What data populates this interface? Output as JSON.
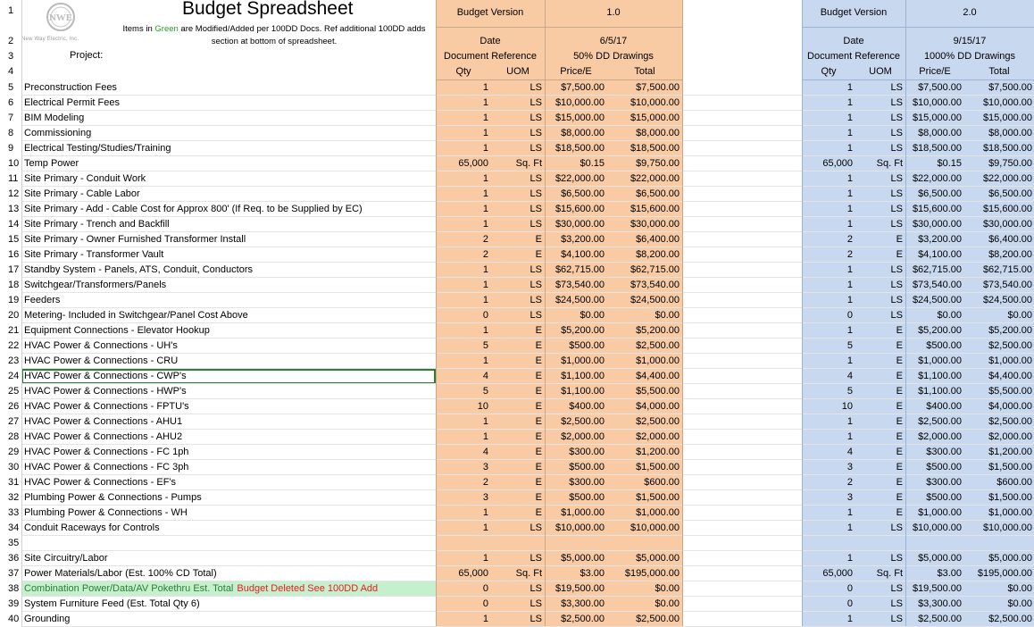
{
  "header": {
    "title": "Budget Spreadsheet",
    "logo_caption": "New Way Electric, Inc.",
    "note_prefix": "Items in ",
    "note_green": "Green",
    "note_suffix": " are Modified/Added per 100DD Docs. Ref additional 100DD adds section at bottom of spreadsheet.",
    "project_label": "Project:"
  },
  "version_a": {
    "version_label": "Budget Version",
    "version_value": "1.0",
    "date_label": "Date",
    "date_value": "6/5/17",
    "docref_label": "Document Reference",
    "docref_value": "50% DD Drawings",
    "col_qty": "Qty",
    "col_uom": "UOM",
    "col_price": "Price/E",
    "col_total": "Total"
  },
  "version_b": {
    "version_label": "Budget Version",
    "version_value": "2.0",
    "date_label": "Date",
    "date_value": "9/15/17",
    "docref_label": "Document Reference",
    "docref_value": "1000% DD Drawings",
    "col_qty": "Qty",
    "col_uom": "UOM",
    "col_price": "Price/E",
    "col_total": "Total"
  },
  "row_numbers": [
    "1",
    "2",
    "3",
    "4"
  ],
  "rows": [
    {
      "n": "5",
      "desc": "Preconstruction Fees",
      "a": [
        "1",
        "LS",
        "$7,500.00",
        "$7,500.00"
      ],
      "b": [
        "1",
        "LS",
        "$7,500.00",
        "$7,500.00"
      ]
    },
    {
      "n": "6",
      "desc": "Electrical Permit Fees",
      "a": [
        "1",
        "LS",
        "$10,000.00",
        "$10,000.00"
      ],
      "b": [
        "1",
        "LS",
        "$10,000.00",
        "$10,000.00"
      ]
    },
    {
      "n": "7",
      "desc": "BIM Modeling",
      "a": [
        "1",
        "LS",
        "$15,000.00",
        "$15,000.00"
      ],
      "b": [
        "1",
        "LS",
        "$15,000.00",
        "$15,000.00"
      ]
    },
    {
      "n": "8",
      "desc": "Commissioning",
      "a": [
        "1",
        "LS",
        "$8,000.00",
        "$8,000.00"
      ],
      "b": [
        "1",
        "LS",
        "$8,000.00",
        "$8,000.00"
      ]
    },
    {
      "n": "9",
      "desc": "Electrical Testing/Studies/Training",
      "a": [
        "1",
        "LS",
        "$18,500.00",
        "$18,500.00"
      ],
      "b": [
        "1",
        "LS",
        "$18,500.00",
        "$18,500.00"
      ]
    },
    {
      "n": "10",
      "desc": "Temp Power",
      "a": [
        "65,000",
        "Sq. Ft",
        "$0.15",
        "$9,750.00"
      ],
      "b": [
        "65,000",
        "Sq. Ft",
        "$0.15",
        "$9,750.00"
      ]
    },
    {
      "n": "11",
      "desc": "Site Primary - Conduit Work",
      "a": [
        "1",
        "LS",
        "$22,000.00",
        "$22,000.00"
      ],
      "b": [
        "1",
        "LS",
        "$22,000.00",
        "$22,000.00"
      ]
    },
    {
      "n": "12",
      "desc": "Site Primary - Cable Labor",
      "a": [
        "1",
        "LS",
        "$6,500.00",
        "$6,500.00"
      ],
      "b": [
        "1",
        "LS",
        "$6,500.00",
        "$6,500.00"
      ]
    },
    {
      "n": "13",
      "desc": "Site Primary - Add - Cable Cost for Approx 800' (If Req. to be Supplied by EC)",
      "a": [
        "1",
        "LS",
        "$15,600.00",
        "$15,600.00"
      ],
      "b": [
        "1",
        "LS",
        "$15,600.00",
        "$15,600.00"
      ]
    },
    {
      "n": "14",
      "desc": "Site Primary - Trench and Backfill",
      "a": [
        "1",
        "LS",
        "$30,000.00",
        "$30,000.00"
      ],
      "b": [
        "1",
        "LS",
        "$30,000.00",
        "$30,000.00"
      ]
    },
    {
      "n": "15",
      "desc": "Site Primary - Owner Furnished Transformer Install",
      "a": [
        "2",
        "E",
        "$3,200.00",
        "$6,400.00"
      ],
      "b": [
        "2",
        "E",
        "$3,200.00",
        "$6,400.00"
      ]
    },
    {
      "n": "16",
      "desc": "Site Primary - Transformer Vault",
      "a": [
        "2",
        "E",
        "$4,100.00",
        "$8,200.00"
      ],
      "b": [
        "2",
        "E",
        "$4,100.00",
        "$8,200.00"
      ]
    },
    {
      "n": "17",
      "desc": "Standby System - Panels, ATS, Conduit, Conductors",
      "a": [
        "1",
        "LS",
        "$62,715.00",
        "$62,715.00"
      ],
      "b": [
        "1",
        "LS",
        "$62,715.00",
        "$62,715.00"
      ]
    },
    {
      "n": "18",
      "desc": "Switchgear/Transformers/Panels",
      "a": [
        "1",
        "LS",
        "$73,540.00",
        "$73,540.00"
      ],
      "b": [
        "1",
        "LS",
        "$73,540.00",
        "$73,540.00"
      ]
    },
    {
      "n": "19",
      "desc": "Feeders",
      "a": [
        "1",
        "LS",
        "$24,500.00",
        "$24,500.00"
      ],
      "b": [
        "1",
        "LS",
        "$24,500.00",
        "$24,500.00"
      ]
    },
    {
      "n": "20",
      "desc": "Metering- Included in Switchgear/Panel Cost Above",
      "a": [
        "0",
        "LS",
        "$0.00",
        "$0.00"
      ],
      "b": [
        "0",
        "LS",
        "$0.00",
        "$0.00"
      ]
    },
    {
      "n": "21",
      "desc": "Equipment Connections - Elevator Hookup",
      "a": [
        "1",
        "E",
        "$5,200.00",
        "$5,200.00"
      ],
      "b": [
        "1",
        "E",
        "$5,200.00",
        "$5,200.00"
      ]
    },
    {
      "n": "22",
      "desc": "HVAC Power & Connections - UH's",
      "a": [
        "5",
        "E",
        "$500.00",
        "$2,500.00"
      ],
      "b": [
        "5",
        "E",
        "$500.00",
        "$2,500.00"
      ]
    },
    {
      "n": "23",
      "desc": "HVAC Power & Connections - CRU",
      "a": [
        "1",
        "E",
        "$1,000.00",
        "$1,000.00"
      ],
      "b": [
        "1",
        "E",
        "$1,000.00",
        "$1,000.00"
      ]
    },
    {
      "n": "24",
      "desc": "HVAC Power & Connections - CWP's",
      "a": [
        "4",
        "E",
        "$1,100.00",
        "$4,400.00"
      ],
      "b": [
        "4",
        "E",
        "$1,100.00",
        "$4,400.00"
      ],
      "selected": true
    },
    {
      "n": "25",
      "desc": "HVAC Power & Connections - HWP's",
      "a": [
        "5",
        "E",
        "$1,100.00",
        "$5,500.00"
      ],
      "b": [
        "5",
        "E",
        "$1,100.00",
        "$5,500.00"
      ]
    },
    {
      "n": "26",
      "desc": "HVAC Power & Connections - FPTU's",
      "a": [
        "10",
        "E",
        "$400.00",
        "$4,000.00"
      ],
      "b": [
        "10",
        "E",
        "$400.00",
        "$4,000.00"
      ]
    },
    {
      "n": "27",
      "desc": "HVAC Power & Connections - AHU1",
      "a": [
        "1",
        "E",
        "$2,500.00",
        "$2,500.00"
      ],
      "b": [
        "1",
        "E",
        "$2,500.00",
        "$2,500.00"
      ]
    },
    {
      "n": "28",
      "desc": "HVAC Power & Connections - AHU2",
      "a": [
        "1",
        "E",
        "$2,000.00",
        "$2,000.00"
      ],
      "b": [
        "1",
        "E",
        "$2,000.00",
        "$2,000.00"
      ]
    },
    {
      "n": "29",
      "desc": "HVAC Power & Connections - FC 1ph",
      "a": [
        "4",
        "E",
        "$300.00",
        "$1,200.00"
      ],
      "b": [
        "4",
        "E",
        "$300.00",
        "$1,200.00"
      ]
    },
    {
      "n": "30",
      "desc": "HVAC Power & Connections - FC 3ph",
      "a": [
        "3",
        "E",
        "$500.00",
        "$1,500.00"
      ],
      "b": [
        "3",
        "E",
        "$500.00",
        "$1,500.00"
      ]
    },
    {
      "n": "31",
      "desc": "HVAC Power & Connections - EF's",
      "a": [
        "2",
        "E",
        "$300.00",
        "$600.00"
      ],
      "b": [
        "2",
        "E",
        "$300.00",
        "$600.00"
      ]
    },
    {
      "n": "32",
      "desc": "Plumbing Power & Connections - Pumps",
      "a": [
        "3",
        "E",
        "$500.00",
        "$1,500.00"
      ],
      "b": [
        "3",
        "E",
        "$500.00",
        "$1,500.00"
      ]
    },
    {
      "n": "33",
      "desc": "Plumbing Power & Connections - WH",
      "a": [
        "1",
        "E",
        "$1,000.00",
        "$1,000.00"
      ],
      "b": [
        "1",
        "E",
        "$1,000.00",
        "$1,000.00"
      ]
    },
    {
      "n": "34",
      "desc": "Conduit Raceways for Controls",
      "a": [
        "1",
        "LS",
        "$10,000.00",
        "$10,000.00"
      ],
      "b": [
        "1",
        "LS",
        "$10,000.00",
        "$10,000.00"
      ]
    },
    {
      "n": "35",
      "desc": "",
      "a": [
        "",
        "",
        "",
        ""
      ],
      "b": [
        "",
        "",
        "",
        ""
      ]
    },
    {
      "n": "36",
      "desc": "Site Circuitry/Labor",
      "a": [
        "1",
        "LS",
        "$5,000.00",
        "$5,000.00"
      ],
      "b": [
        "1",
        "LS",
        "$5,000.00",
        "$5,000.00"
      ]
    },
    {
      "n": "37",
      "desc": "Power Materials/Labor (Est. 100% CD Total)",
      "a": [
        "65,000",
        "Sq. Ft",
        "$3.00",
        "$195,000.00"
      ],
      "b": [
        "65,000",
        "Sq. Ft",
        "$3.00",
        "$195,000.00"
      ]
    },
    {
      "n": "38",
      "desc": "Combination Power/Data/AV Pokethru Est. Total",
      "desc_red": "Budget Deleted See 100DD Add",
      "a": [
        "0",
        "LS",
        "$19,500.00",
        "$0.00"
      ],
      "b": [
        "0",
        "LS",
        "$19,500.00",
        "$0.00"
      ],
      "green": true
    },
    {
      "n": "39",
      "desc": "System Furniture Feed (Est. Total Qty 6)",
      "a": [
        "0",
        "LS",
        "$3,300.00",
        "$0.00"
      ],
      "b": [
        "0",
        "LS",
        "$3,300.00",
        "$0.00"
      ]
    },
    {
      "n": "40",
      "desc": "Grounding",
      "a": [
        "1",
        "LS",
        "$2,500.00",
        "$2,500.00"
      ],
      "b": [
        "1",
        "LS",
        "$2,500.00",
        "$2,500.00"
      ]
    }
  ]
}
